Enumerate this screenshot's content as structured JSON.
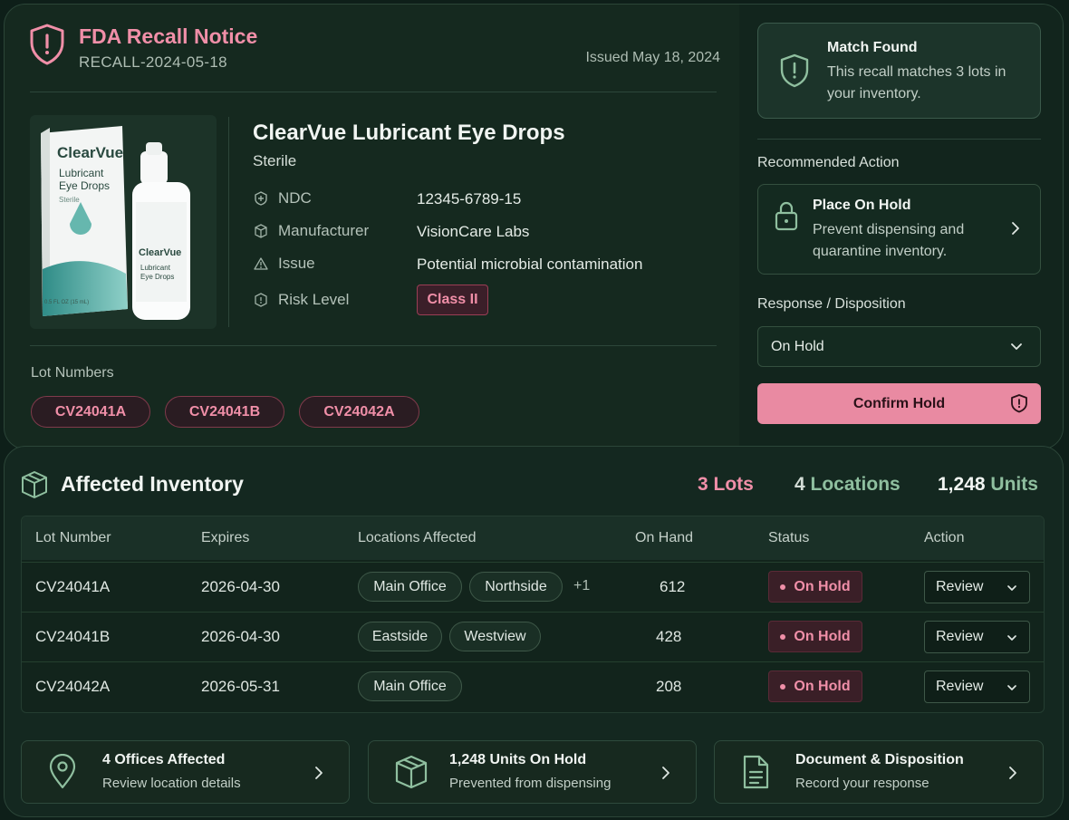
{
  "recall": {
    "title": "FDA Recall Notice",
    "id": "RECALL-2024-05-18",
    "issued": "Issued May 18, 2024"
  },
  "product": {
    "name": "ClearVue Lubricant Eye Drops",
    "subtitle": "Sterile",
    "attributes": [
      {
        "label": "NDC",
        "value": "12345-6789-15",
        "icon": "ndc-icon"
      },
      {
        "label": "Manufacturer",
        "value": "VisionCare Labs",
        "icon": "manufacturer-icon"
      },
      {
        "label": "Issue",
        "value": "Potential microbial contamination",
        "icon": "warning-icon"
      },
      {
        "label": "Risk Level",
        "value": "Class II",
        "icon": "risk-icon"
      }
    ],
    "image_text": {
      "brand": "ClearVue",
      "line1": "Lubricant",
      "line2": "Eye Drops",
      "sterile": "Sterile",
      "volume": "0.5 FL OZ (15 mL)"
    }
  },
  "lots": {
    "label": "Lot Numbers",
    "items": [
      "CV24041A",
      "CV24041B",
      "CV24042A"
    ]
  },
  "match": {
    "title": "Match Found",
    "text": "This recall matches 3 lots in your inventory."
  },
  "recommended": {
    "label": "Recommended Action",
    "title": "Place On Hold",
    "text": "Prevent dispensing and quarantine inventory."
  },
  "response": {
    "label": "Response / Disposition",
    "selected": "On Hold",
    "confirm_label": "Confirm Hold"
  },
  "inventory": {
    "title": "Affected Inventory",
    "stats": [
      {
        "num": "3",
        "unit": "Lots"
      },
      {
        "num": "4",
        "unit": "Locations"
      },
      {
        "num": "1,248",
        "unit": "Units"
      }
    ],
    "columns": [
      "Lot Number",
      "Expires",
      "Locations Affected",
      "On Hand",
      "Status",
      "Action"
    ],
    "rows": [
      {
        "lot": "CV24041A",
        "expires": "2026-04-30",
        "locations": [
          "Main Office",
          "Northside"
        ],
        "more": "+1",
        "on_hand": "612",
        "status": "On Hold",
        "action": "Review"
      },
      {
        "lot": "CV24041B",
        "expires": "2026-04-30",
        "locations": [
          "Eastside",
          "Westview"
        ],
        "more": "",
        "on_hand": "428",
        "status": "On Hold",
        "action": "Review"
      },
      {
        "lot": "CV24042A",
        "expires": "2026-05-31",
        "locations": [
          "Main Office"
        ],
        "more": "",
        "on_hand": "208",
        "status": "On Hold",
        "action": "Review"
      }
    ]
  },
  "cards": [
    {
      "title": "4 Offices Affected",
      "sub": "Review location details",
      "icon": "location-pin-icon"
    },
    {
      "title": "1,248 Units On Hold",
      "sub": "Prevented from dispensing",
      "icon": "package-icon"
    },
    {
      "title": "Document & Disposition",
      "sub": "Record your response",
      "icon": "document-icon"
    }
  ],
  "colors": {
    "accent_pink": "#f08fa8",
    "accent_green": "#8fbf9f",
    "background": "#0e1f19"
  }
}
